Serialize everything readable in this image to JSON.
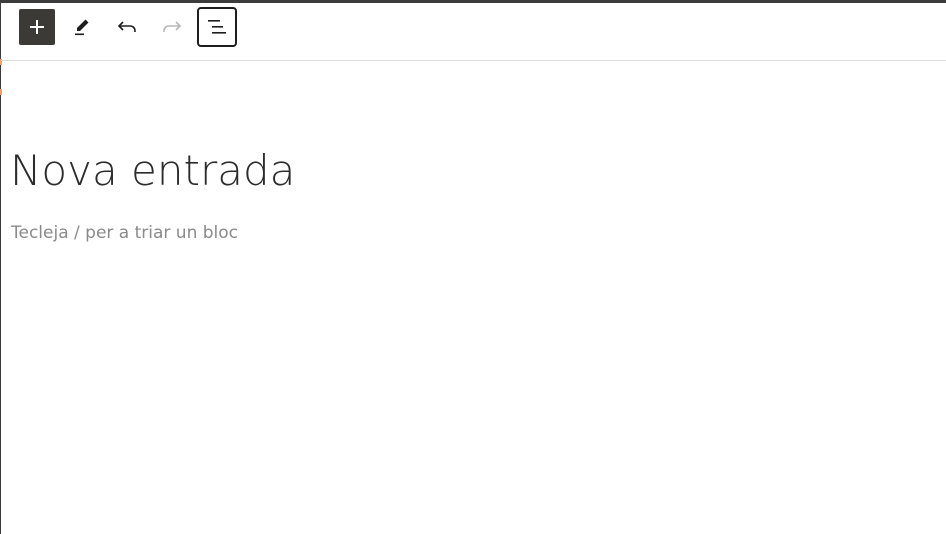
{
  "toolbar": {
    "buttons": [
      {
        "name": "inserter",
        "icon": "plus-icon",
        "active": true
      },
      {
        "name": "tools",
        "icon": "pencil-icon"
      },
      {
        "name": "undo",
        "icon": "undo-icon",
        "enabled": true
      },
      {
        "name": "redo",
        "icon": "redo-icon",
        "enabled": false
      },
      {
        "name": "document-overview",
        "icon": "list-view-icon",
        "pressed": true
      }
    ]
  },
  "editor": {
    "title": "Nova entrada",
    "block_placeholder": "Tecleja / per a triar un bloc"
  },
  "colors": {
    "inserter_bg": "#3c3a36",
    "title_text": "#2c2c2c",
    "placeholder_text": "#8a8a8a",
    "redo_disabled": "#b8b8b8"
  }
}
